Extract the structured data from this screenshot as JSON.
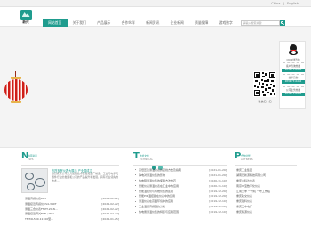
{
  "topbar": {
    "languages": [
      "China",
      "|",
      "English"
    ]
  },
  "header": {
    "logo_text": "新兴",
    "nav": [
      "网站首页",
      "关于我们",
      "产品展示",
      "合作伙伴",
      "新闻资讯",
      "企业新闻",
      "质量保障",
      "游戏数字"
    ],
    "search_placeholder": "请输入搜索关键",
    "accent_color": "#1f9c8e"
  },
  "sidepanel": {
    "qq_label": "QQ在线咨询",
    "sales_label": "客户咨询热线",
    "sales_phone": "0836-7314484",
    "tech_label": "技术咨询",
    "tech_phone": "0836-7314484",
    "after_label": "公司业务热线",
    "after_phone": "0836-7314484"
  },
  "qr": {
    "caption": "微信扫一扫"
  },
  "news": {
    "big_letter": "N",
    "title_cn": "新闻资讯",
    "title_en": "EWS",
    "feature_title": "热烈祝贺仪表大展示 产业园成立",
    "feature_desc": "热烈祝贺公司大力加强技术研发和生产制造，工业与电子元器件行业的发展和公司的产品提升和发展，具有行业领先的技术...",
    "items": [
      {
        "title": "测温传感仪表DL5",
        "date": "[2024-02-22]"
      },
      {
        "title": "测温接近传感仪CS4-340T",
        "date": "[2024-02-22]"
      },
      {
        "title": "测温三合仪表FT-PT-20-N...",
        "date": "[2024-02-22]"
      },
      {
        "title": "测温接近开关NPN / PCA",
        "date": "[2024-02-22]"
      },
      {
        "title": "TM70L500.11100型...",
        "date": "[2024-01-25]"
      }
    ]
  },
  "tech": {
    "big_letter": "T",
    "title_cn": "技术文章",
    "title_en": "ECHNICAL",
    "items": [
      {
        "title": "高低压及测温仪表的接线方法及指南",
        "date": "[2021-01-29]"
      },
      {
        "title": "静电对测温仪表的影响",
        "date": "[2021-01-29]"
      },
      {
        "title": "热电阻测温仪表的使用方法技巧",
        "date": "[2020-11-10]"
      },
      {
        "title": "智能仪表测温仪表在工业中的应用",
        "date": "[2020-11-10]"
      },
      {
        "title": "智能温控仪与传统仪表的区别",
        "date": "[2019-12-29]"
      },
      {
        "title": "智能PID温控器在仪表中的应用",
        "date": "[2019-12-29]"
      },
      {
        "title": "测温仪表在高温环境中的应用",
        "date": "[2019-12-10]"
      },
      {
        "title": "工业温度传感器的分类",
        "date": "[2019-12-10]"
      },
      {
        "title": "热电偶测温仪表的特点与应用范围",
        "date": "[2019-12-10]"
      }
    ]
  },
  "partners": {
    "big_letter": "P",
    "title_cn": "合作伙伴",
    "title_en": "ARTNERS",
    "items": [
      "重庆工业集团",
      "湖南宏新源科技有限公司",
      "重庆川科达仪表",
      "南京中宝数字化仪表",
      "江南大学 一开机 一号工作站",
      "重庆轨交仪表",
      "重庆锐科仪表",
      "重庆天中电厂",
      "重庆科源仪表"
    ]
  }
}
